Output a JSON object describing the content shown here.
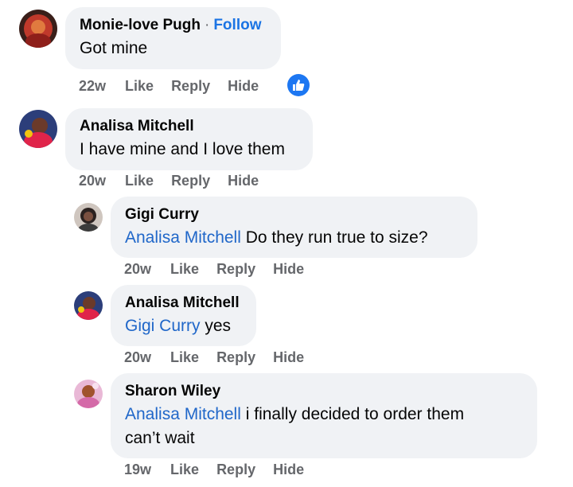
{
  "comments": [
    {
      "author": "Monie-love Pugh",
      "follow": "Follow",
      "separator": "·",
      "text": "Got mine",
      "time": "22w",
      "like": "Like",
      "reply": "Reply",
      "hide": "Hide",
      "reaction_icon": "thumbs-up-icon"
    },
    {
      "author": "Analisa Mitchell",
      "text": "I have mine and I love them",
      "time": "20w",
      "like": "Like",
      "reply": "Reply",
      "hide": "Hide"
    }
  ],
  "replies": [
    {
      "author": "Gigi Curry",
      "mention": "Analisa Mitchell",
      "text": "Do they run true to size?",
      "time": "20w",
      "like": "Like",
      "reply": "Reply",
      "hide": "Hide"
    },
    {
      "author": "Analisa Mitchell",
      "mention": "Gigi Curry",
      "text": "yes",
      "time": "20w",
      "like": "Like",
      "reply": "Reply",
      "hide": "Hide"
    },
    {
      "author": "Sharon Wiley",
      "mention": "Analisa Mitchell",
      "text_line1": "i finally decided to order them",
      "text_line2": "can’t wait",
      "time": "19w",
      "like": "Like",
      "reply": "Reply",
      "hide": "Hide"
    }
  ],
  "colors": {
    "bubble": "#f0f2f5",
    "link_blue": "#2067c9",
    "secondary_text": "#65676b",
    "reaction_blue": "#1d77f2"
  }
}
